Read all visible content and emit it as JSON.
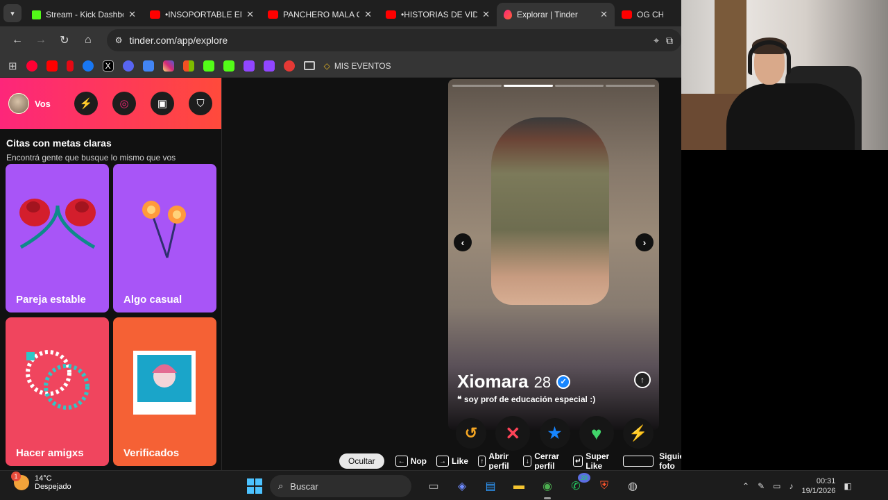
{
  "browser": {
    "tabs": [
      {
        "title": "Stream - Kick Dashbo",
        "icon": "kick"
      },
      {
        "title": "•INSOPORTABLE EN L",
        "icon": "youtube"
      },
      {
        "title": "PANCHERO MALA OF",
        "icon": "youtube"
      },
      {
        "title": "•HISTORIAS DE VIDA",
        "icon": "youtube"
      },
      {
        "title": "Explorar | Tinder",
        "icon": "tinder"
      },
      {
        "title": "OG CHILL",
        "icon": "youtube"
      }
    ],
    "url": "tinder.com/app/explore",
    "bookmark_label": "MIS EVENTOS"
  },
  "sidebar": {
    "user_label": "Vos",
    "title": "Citas con metas claras",
    "subtitle": "Encontrá gente que busque lo mismo que vos",
    "cards": [
      {
        "label": "Pareja estable",
        "color": "#a855f7"
      },
      {
        "label": "Algo casual",
        "color": "#a855f7"
      },
      {
        "label": "Hacer amigxs",
        "color": "#f0455e"
      },
      {
        "label": "Verificados",
        "color": "#f56135"
      }
    ]
  },
  "profile": {
    "name": "Xiomara",
    "age": "28",
    "bio": "soy prof de educación especial :)",
    "photo_index": 2,
    "photo_count": 4
  },
  "shortcuts": {
    "hide": "Ocultar",
    "nope": "Nop",
    "like": "Like",
    "open": "Abrir perfil",
    "close": "Cerrar perfil",
    "superlike": "Super Like",
    "next": "Siguiente foto"
  },
  "taskbar": {
    "temperature": "14°C",
    "weather": "Despejado",
    "weather_badge": "1",
    "search_placeholder": "Buscar",
    "whatsapp_badge": "39",
    "time": "00:31",
    "date": "19/1/2026"
  }
}
